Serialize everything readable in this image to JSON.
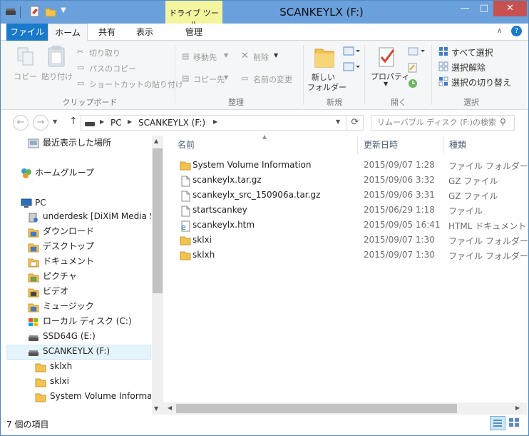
{
  "window": {
    "title": "SCANKEYLX (F:)",
    "context_tab_group": "ドライブ ツール",
    "minimize": "—",
    "maximize": "□",
    "close": "✕"
  },
  "tabs": {
    "file": "ファイル",
    "home": "ホーム",
    "share": "共有",
    "view": "表示",
    "manage": "管理"
  },
  "ribbon": {
    "clipboard": {
      "label": "クリップボード",
      "copy": "コピー",
      "paste": "貼り付け",
      "cut": "切り取り",
      "copy_path": "パスのコピー",
      "paste_shortcut": "ショートカットの貼り付け"
    },
    "organize": {
      "label": "整理",
      "move_to": "移動先",
      "copy_to": "コピー先",
      "delete": "削除",
      "rename": "名前の変更"
    },
    "new": {
      "label": "新規",
      "new_folder_line1": "新しい",
      "new_folder_line2": "フォルダー"
    },
    "open": {
      "label": "開く",
      "properties": "プロパティ"
    },
    "select": {
      "label": "選択",
      "select_all": "すべて選択",
      "select_none": "選択解除",
      "invert": "選択の切り替え"
    }
  },
  "address": {
    "crumbs": [
      "PC",
      "SCANKEYLX (F:)"
    ],
    "search_placeholder": "リムーバブル ディスク (F:)の検索"
  },
  "nav": {
    "recent": "最近表示した場所",
    "homegroup": "ホームグループ",
    "pc": "PC",
    "items": [
      {
        "label": "underdesk [DiXiM Media S",
        "icon": "media-server-icon"
      },
      {
        "label": "ダウンロード",
        "icon": "downloads-icon"
      },
      {
        "label": "デスクトップ",
        "icon": "desktop-icon"
      },
      {
        "label": "ドキュメント",
        "icon": "documents-icon"
      },
      {
        "label": "ピクチャ",
        "icon": "pictures-icon"
      },
      {
        "label": "ビデオ",
        "icon": "videos-icon"
      },
      {
        "label": "ミュージック",
        "icon": "music-icon"
      },
      {
        "label": "ローカル ディスク (C:)",
        "icon": "local-disk-icon"
      },
      {
        "label": "SSD64G (E:)",
        "icon": "drive-icon"
      },
      {
        "label": "SCANKEYLX (F:)",
        "icon": "usb-drive-icon"
      },
      {
        "label": "sklxh",
        "icon": "folder-icon"
      },
      {
        "label": "sklxi",
        "icon": "folder-icon"
      },
      {
        "label": "System Volume Informa",
        "icon": "folder-icon"
      }
    ]
  },
  "columns": {
    "name": "名前",
    "date": "更新日時",
    "type": "種類"
  },
  "files": [
    {
      "name": "System Volume Information",
      "date": "2015/09/07 1:28",
      "type": "ファイル フォルダー",
      "kind": "folder"
    },
    {
      "name": "scankeylx.tar.gz",
      "date": "2015/09/06 3:32",
      "type": "GZ ファイル",
      "kind": "file"
    },
    {
      "name": "scankeylx_src_150906a.tar.gz",
      "date": "2015/09/06 3:31",
      "type": "GZ ファイル",
      "kind": "file"
    },
    {
      "name": "startscankey",
      "date": "2015/06/29 1:18",
      "type": "ファイル",
      "kind": "file"
    },
    {
      "name": "scankeylx.htm",
      "date": "2015/09/05 16:41",
      "type": "HTML ドキュメント",
      "kind": "html"
    },
    {
      "name": "sklxi",
      "date": "2015/09/07 1:30",
      "type": "ファイル フォルダー",
      "kind": "folder"
    },
    {
      "name": "sklxh",
      "date": "2015/09/07 1:30",
      "type": "ファイル フォルダー",
      "kind": "folder"
    }
  ],
  "status": {
    "count": "7 個の項目"
  },
  "colors": {
    "titlebar": "#6aa0dc",
    "file_tab": "#1979ca",
    "context_tab": "#f3f59f",
    "selection": "#e5f3fb",
    "close_button": "#c75050"
  }
}
